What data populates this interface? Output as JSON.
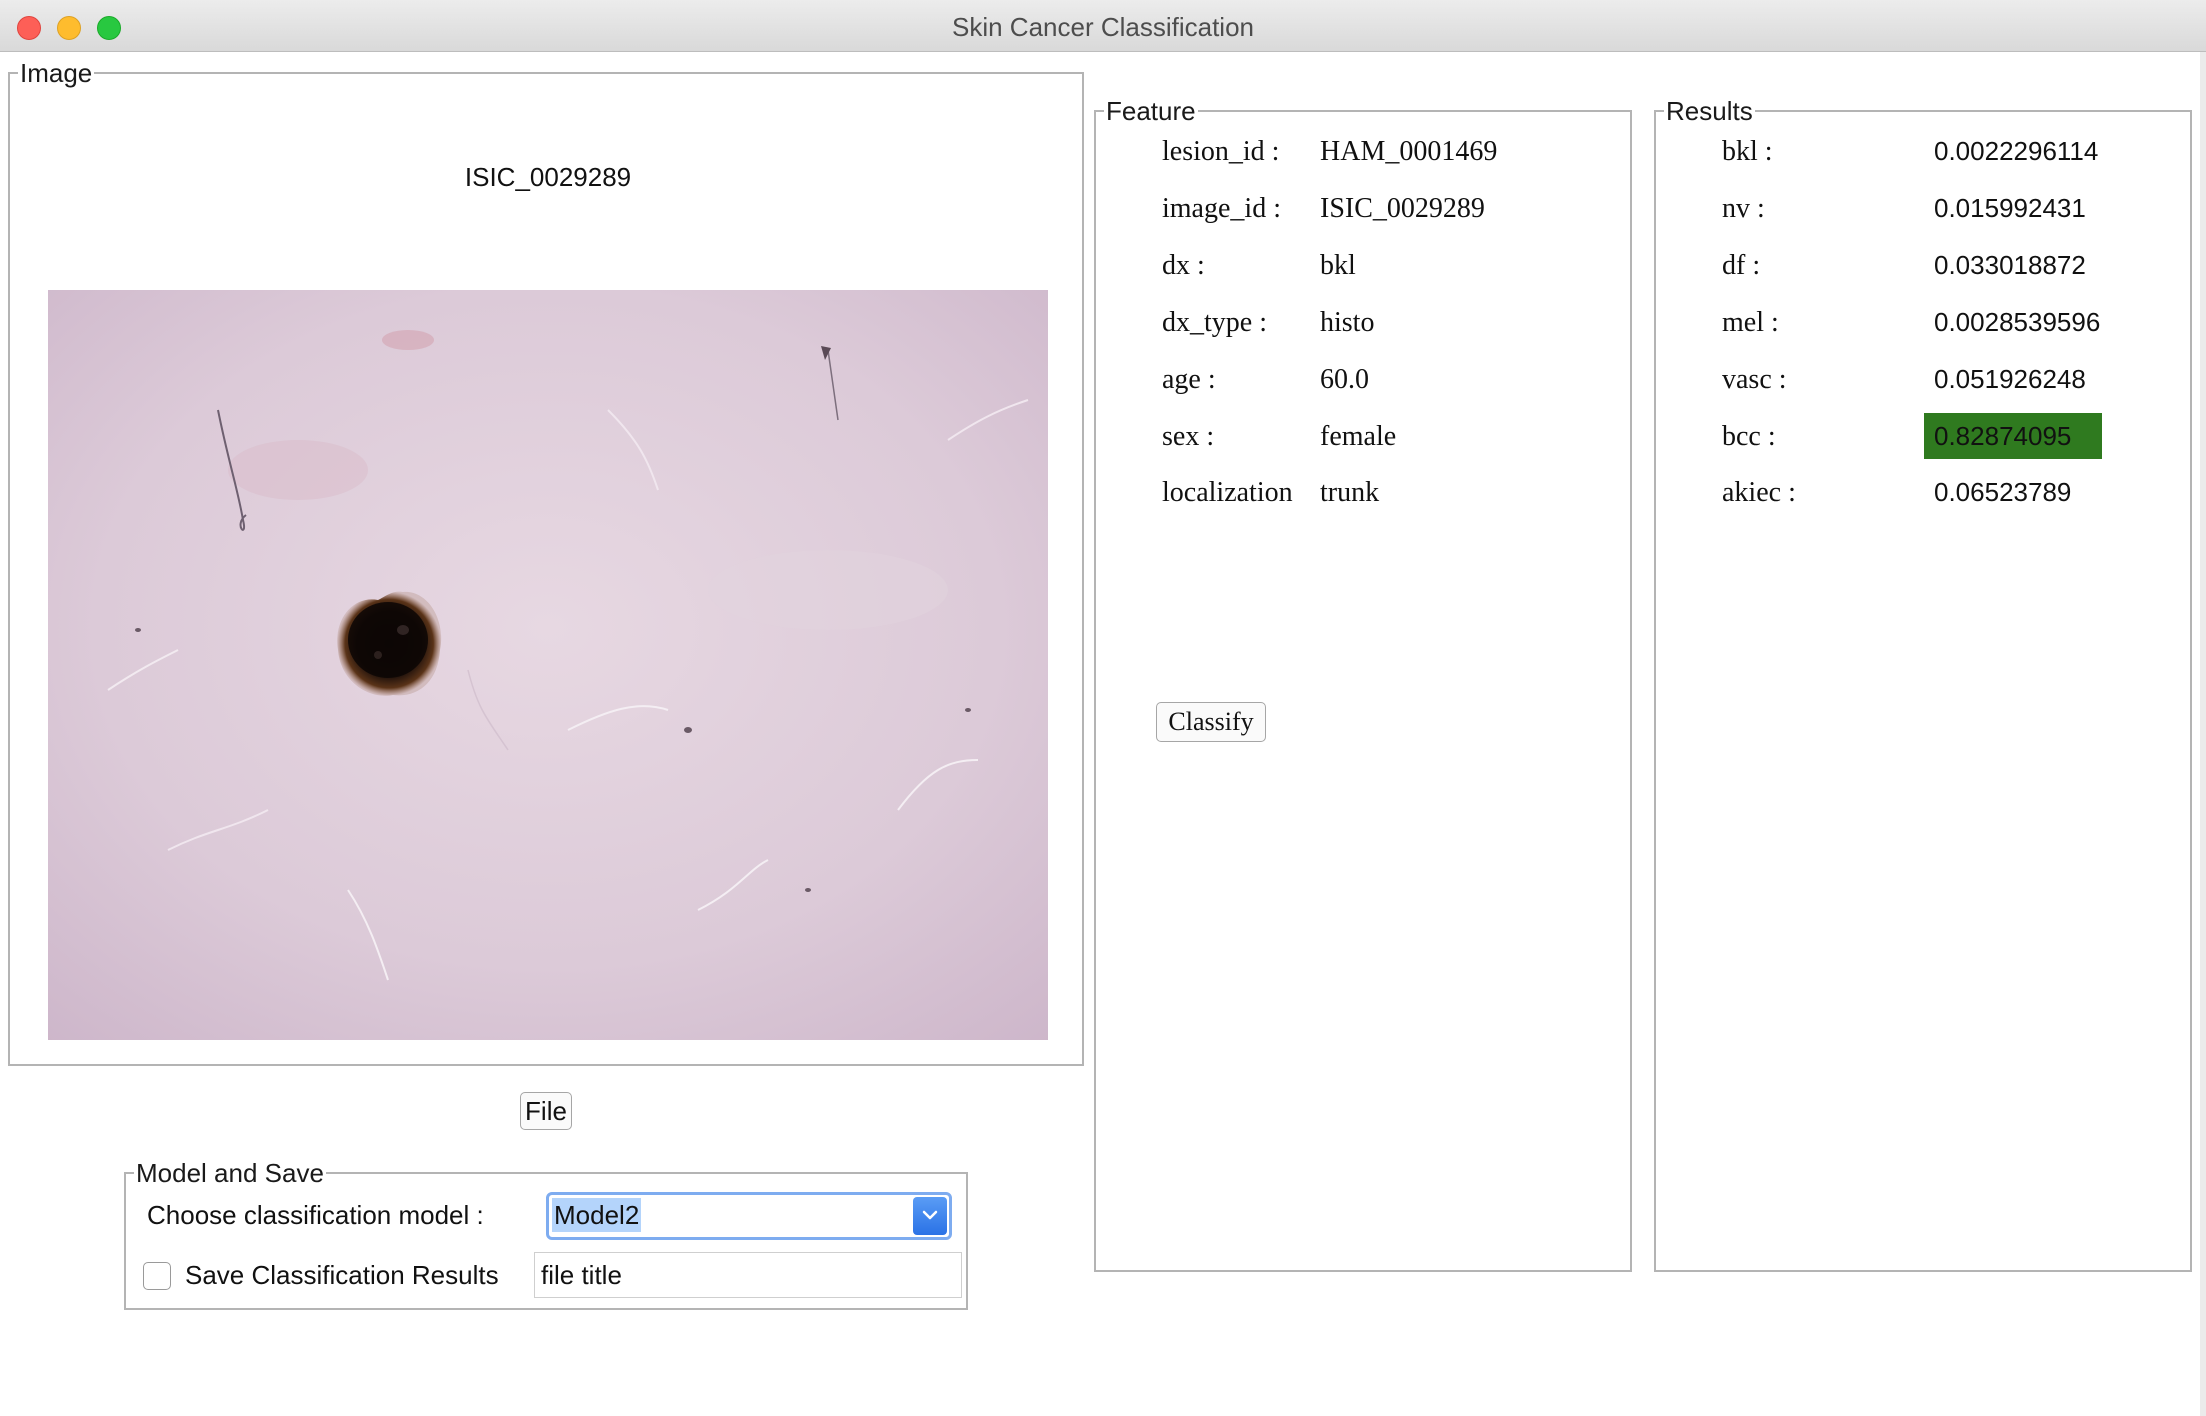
{
  "window": {
    "title": "Skin Cancer Classification"
  },
  "image_panel": {
    "legend": "Image",
    "image_name": "ISIC_0029289",
    "file_button": "File"
  },
  "model_panel": {
    "legend": "Model and Save",
    "choose_label": "Choose classification model :",
    "selected_model": "Model2",
    "save_label": "Save Classification Results",
    "save_checked": false,
    "file_title_value": "file title"
  },
  "feature_panel": {
    "legend": "Feature",
    "rows": [
      {
        "key": "lesion_id :",
        "value": "HAM_0001469"
      },
      {
        "key": "image_id :",
        "value": "ISIC_0029289"
      },
      {
        "key": "dx :",
        "value": "bkl"
      },
      {
        "key": "dx_type :",
        "value": "histo"
      },
      {
        "key": "age :",
        "value": "60.0"
      },
      {
        "key": "sex :",
        "value": "female"
      },
      {
        "key": "localization",
        "value": "trunk"
      }
    ],
    "classify_button": "Classify"
  },
  "results_panel": {
    "legend": "Results",
    "rows": [
      {
        "key": "bkl :",
        "value": "0.0022296114"
      },
      {
        "key": "nv :",
        "value": "0.015992431"
      },
      {
        "key": "df :",
        "value": "0.033018872"
      },
      {
        "key": "mel :",
        "value": "0.0028539596"
      },
      {
        "key": "vasc :",
        "value": "0.051926248"
      },
      {
        "key": "bcc :",
        "value": "0.82874095"
      },
      {
        "key": "akiec :",
        "value": "0.06523789"
      }
    ],
    "highlighted_key": "bcc :",
    "highlight_color": "#2f7a1f"
  }
}
